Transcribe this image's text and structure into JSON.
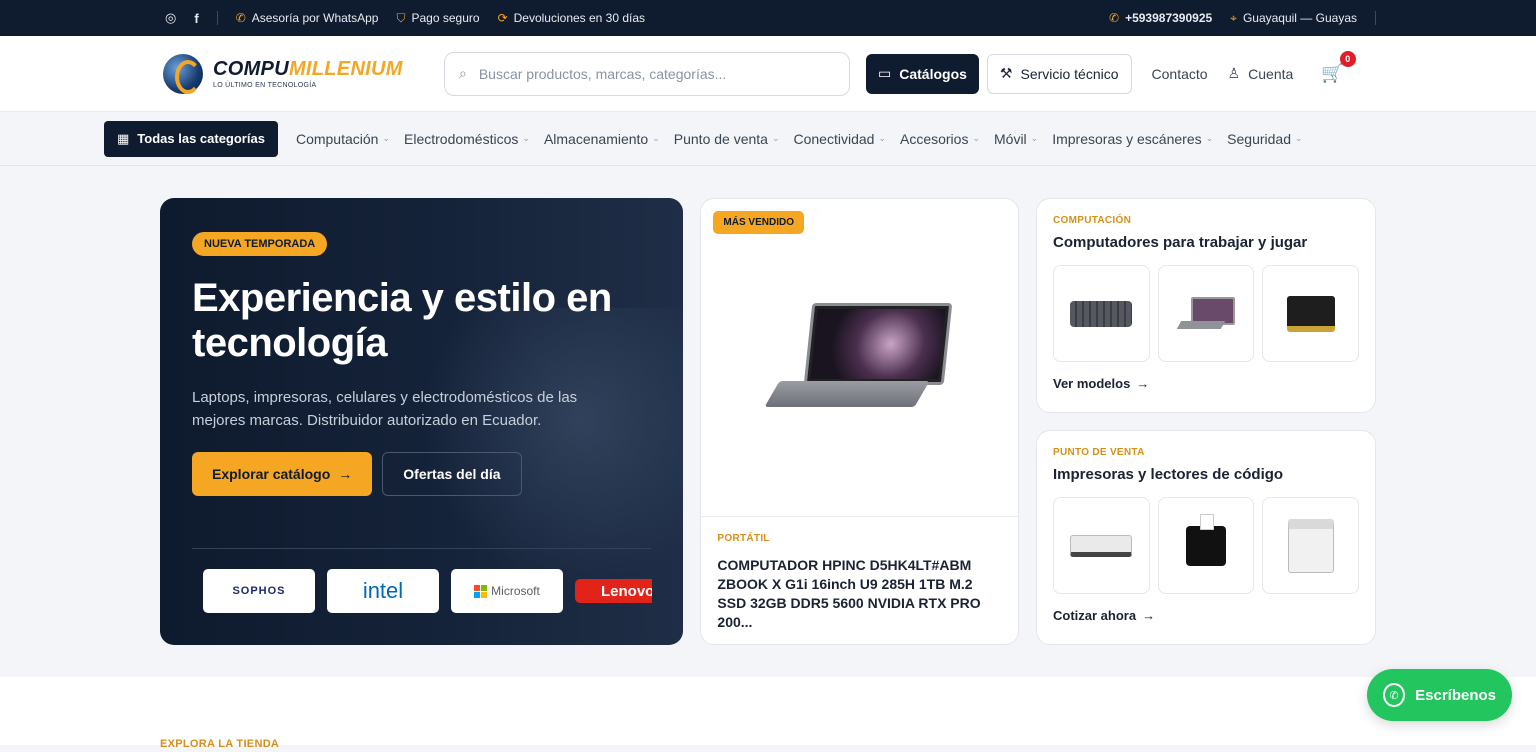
{
  "topbar": {
    "social": [
      "instagram-icon",
      "facebook-icon"
    ],
    "whatsapp": "Asesoría por WhatsApp",
    "payment": "Pago seguro",
    "returns": "Devoluciones en 30 días",
    "phone": "+593987390925",
    "location": "Guayaquil — Guayas"
  },
  "header": {
    "logo_part1": "COMPU",
    "logo_part2": "MILLENIUM",
    "logo_tagline": "LO ÚLTIMO EN TECNOLOGÍA",
    "search_placeholder": "Buscar productos, marcas, categorías...",
    "catalogs": "Catálogos",
    "service": "Servicio técnico",
    "contact": "Contacto",
    "account": "Cuenta",
    "cart_count": "0"
  },
  "nav": {
    "all_categories": "Todas las categorías",
    "categories": [
      "Computación",
      "Electrodomésticos",
      "Almacenamiento",
      "Punto de venta",
      "Conectividad",
      "Accesorios",
      "Móvil",
      "Impresoras y escáneres",
      "Seguridad"
    ]
  },
  "hero": {
    "badge": "NUEVA TEMPORADA",
    "title": "Experiencia y estilo en tecnología",
    "description": "Laptops, impresoras, celulares y electrodomésticos de las mejores marcas. Distribuidor autorizado en Ecuador.",
    "primary_cta": "Explorar catálogo",
    "secondary_cta": "Ofertas del día",
    "brands": [
      "SOPHOS",
      "intel",
      "Microsoft",
      "Lenovo"
    ]
  },
  "featured": {
    "badge": "MÁS VENDIDO",
    "category": "PORTÁTIL",
    "name": "COMPUTADOR HPINC D5HK4LT#ABM ZBOOK X G1i 16inch U9 285H 1TB M.2 SSD 32GB DDR5 5600 NVIDIA RTX PRO 200..."
  },
  "cards": [
    {
      "category": "COMPUTACIÓN",
      "title": "Computadores para trabajar y jugar",
      "link": "Ver modelos"
    },
    {
      "category": "PUNTO DE VENTA",
      "title": "Impresoras y lectores de código",
      "link": "Cotizar ahora"
    }
  ],
  "whatsapp_button": "Escríbenos",
  "explore_label": "EXPLORA LA TIENDA",
  "colors": {
    "navy": "#0f1b2e",
    "accent": "#f5a623",
    "whatsapp": "#22c55e",
    "badge_red": "#e11d2a"
  }
}
